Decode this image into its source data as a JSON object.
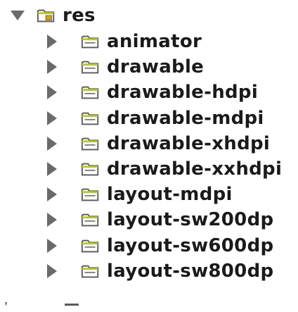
{
  "tree": {
    "root": {
      "label": "res",
      "icon": "resource-folder-icon",
      "expanded": true
    },
    "items": [
      {
        "label": "animator",
        "icon": "folder-icon",
        "expanded": false
      },
      {
        "label": "drawable",
        "icon": "folder-icon",
        "expanded": false
      },
      {
        "label": "drawable-hdpi",
        "icon": "folder-icon",
        "expanded": false
      },
      {
        "label": "drawable-mdpi",
        "icon": "folder-icon",
        "expanded": false
      },
      {
        "label": "drawable-xhdpi",
        "icon": "folder-icon",
        "expanded": false
      },
      {
        "label": "drawable-xxhdpi",
        "icon": "folder-icon",
        "expanded": false
      },
      {
        "label": "layout-mdpi",
        "icon": "folder-icon",
        "expanded": false
      },
      {
        "label": "layout-sw200dp",
        "icon": "folder-icon",
        "expanded": false
      },
      {
        "label": "layout-sw600dp",
        "icon": "folder-icon",
        "expanded": false
      },
      {
        "label": "layout-sw800dp",
        "icon": "folder-icon",
        "expanded": false
      }
    ]
  },
  "colors": {
    "triangle": "#6a6a6a",
    "folder_outline": "#5a5a5a",
    "folder_fill": "#fbfbfb",
    "folder_accent": "#b8c930",
    "res_overlay": "#c9a227"
  }
}
